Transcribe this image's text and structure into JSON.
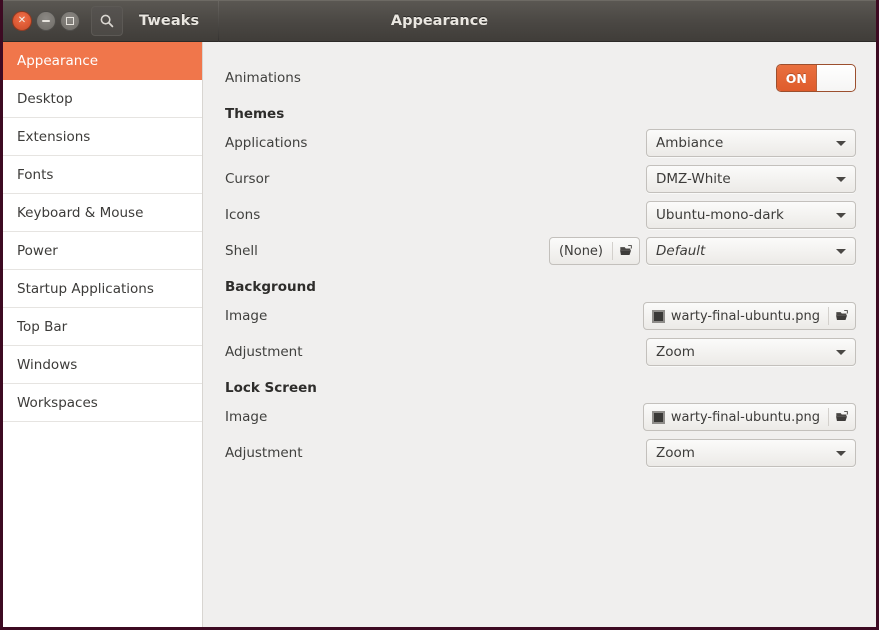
{
  "window": {
    "app_name": "Tweaks",
    "page_title": "Appearance",
    "controls": {
      "close_label": "✕",
      "minimize_name": "minimize",
      "maximize_name": "maximize"
    },
    "search_icon": "search-icon",
    "border_color": "#3d0a22",
    "titlebar_color": "#4a4743"
  },
  "sidebar": {
    "selected": "Appearance",
    "accent_color": "#f0764b",
    "items": [
      {
        "label": "Appearance",
        "selected": true
      },
      {
        "label": "Desktop",
        "selected": false
      },
      {
        "label": "Extensions",
        "selected": false
      },
      {
        "label": "Fonts",
        "selected": false
      },
      {
        "label": "Keyboard & Mouse",
        "selected": false
      },
      {
        "label": "Power",
        "selected": false
      },
      {
        "label": "Startup Applications",
        "selected": false
      },
      {
        "label": "Top Bar",
        "selected": false
      },
      {
        "label": "Windows",
        "selected": false
      },
      {
        "label": "Workspaces",
        "selected": false
      }
    ]
  },
  "content": {
    "animations": {
      "label": "Animations",
      "switch_state": "ON",
      "switch_on": true
    },
    "themes": {
      "heading": "Themes",
      "applications": {
        "label": "Applications",
        "value": "Ambiance"
      },
      "cursor": {
        "label": "Cursor",
        "value": "DMZ-White"
      },
      "icons": {
        "label": "Icons",
        "value": "Ubuntu-mono-dark"
      },
      "shell": {
        "label": "Shell",
        "file_value": "(None)",
        "file_icon": "open-folder-icon",
        "value": "Default",
        "insensitive": true
      }
    },
    "background": {
      "heading": "Background",
      "image": {
        "label": "Image",
        "value": "warty-final-ubuntu.png",
        "thumb_icon": "image-thumbnail-icon",
        "open_icon": "open-folder-icon"
      },
      "adjustment": {
        "label": "Adjustment",
        "value": "Zoom"
      }
    },
    "lock_screen": {
      "heading": "Lock Screen",
      "image": {
        "label": "Image",
        "value": "warty-final-ubuntu.png",
        "thumb_icon": "image-thumbnail-icon",
        "open_icon": "open-folder-icon"
      },
      "adjustment": {
        "label": "Adjustment",
        "value": "Zoom"
      }
    }
  }
}
